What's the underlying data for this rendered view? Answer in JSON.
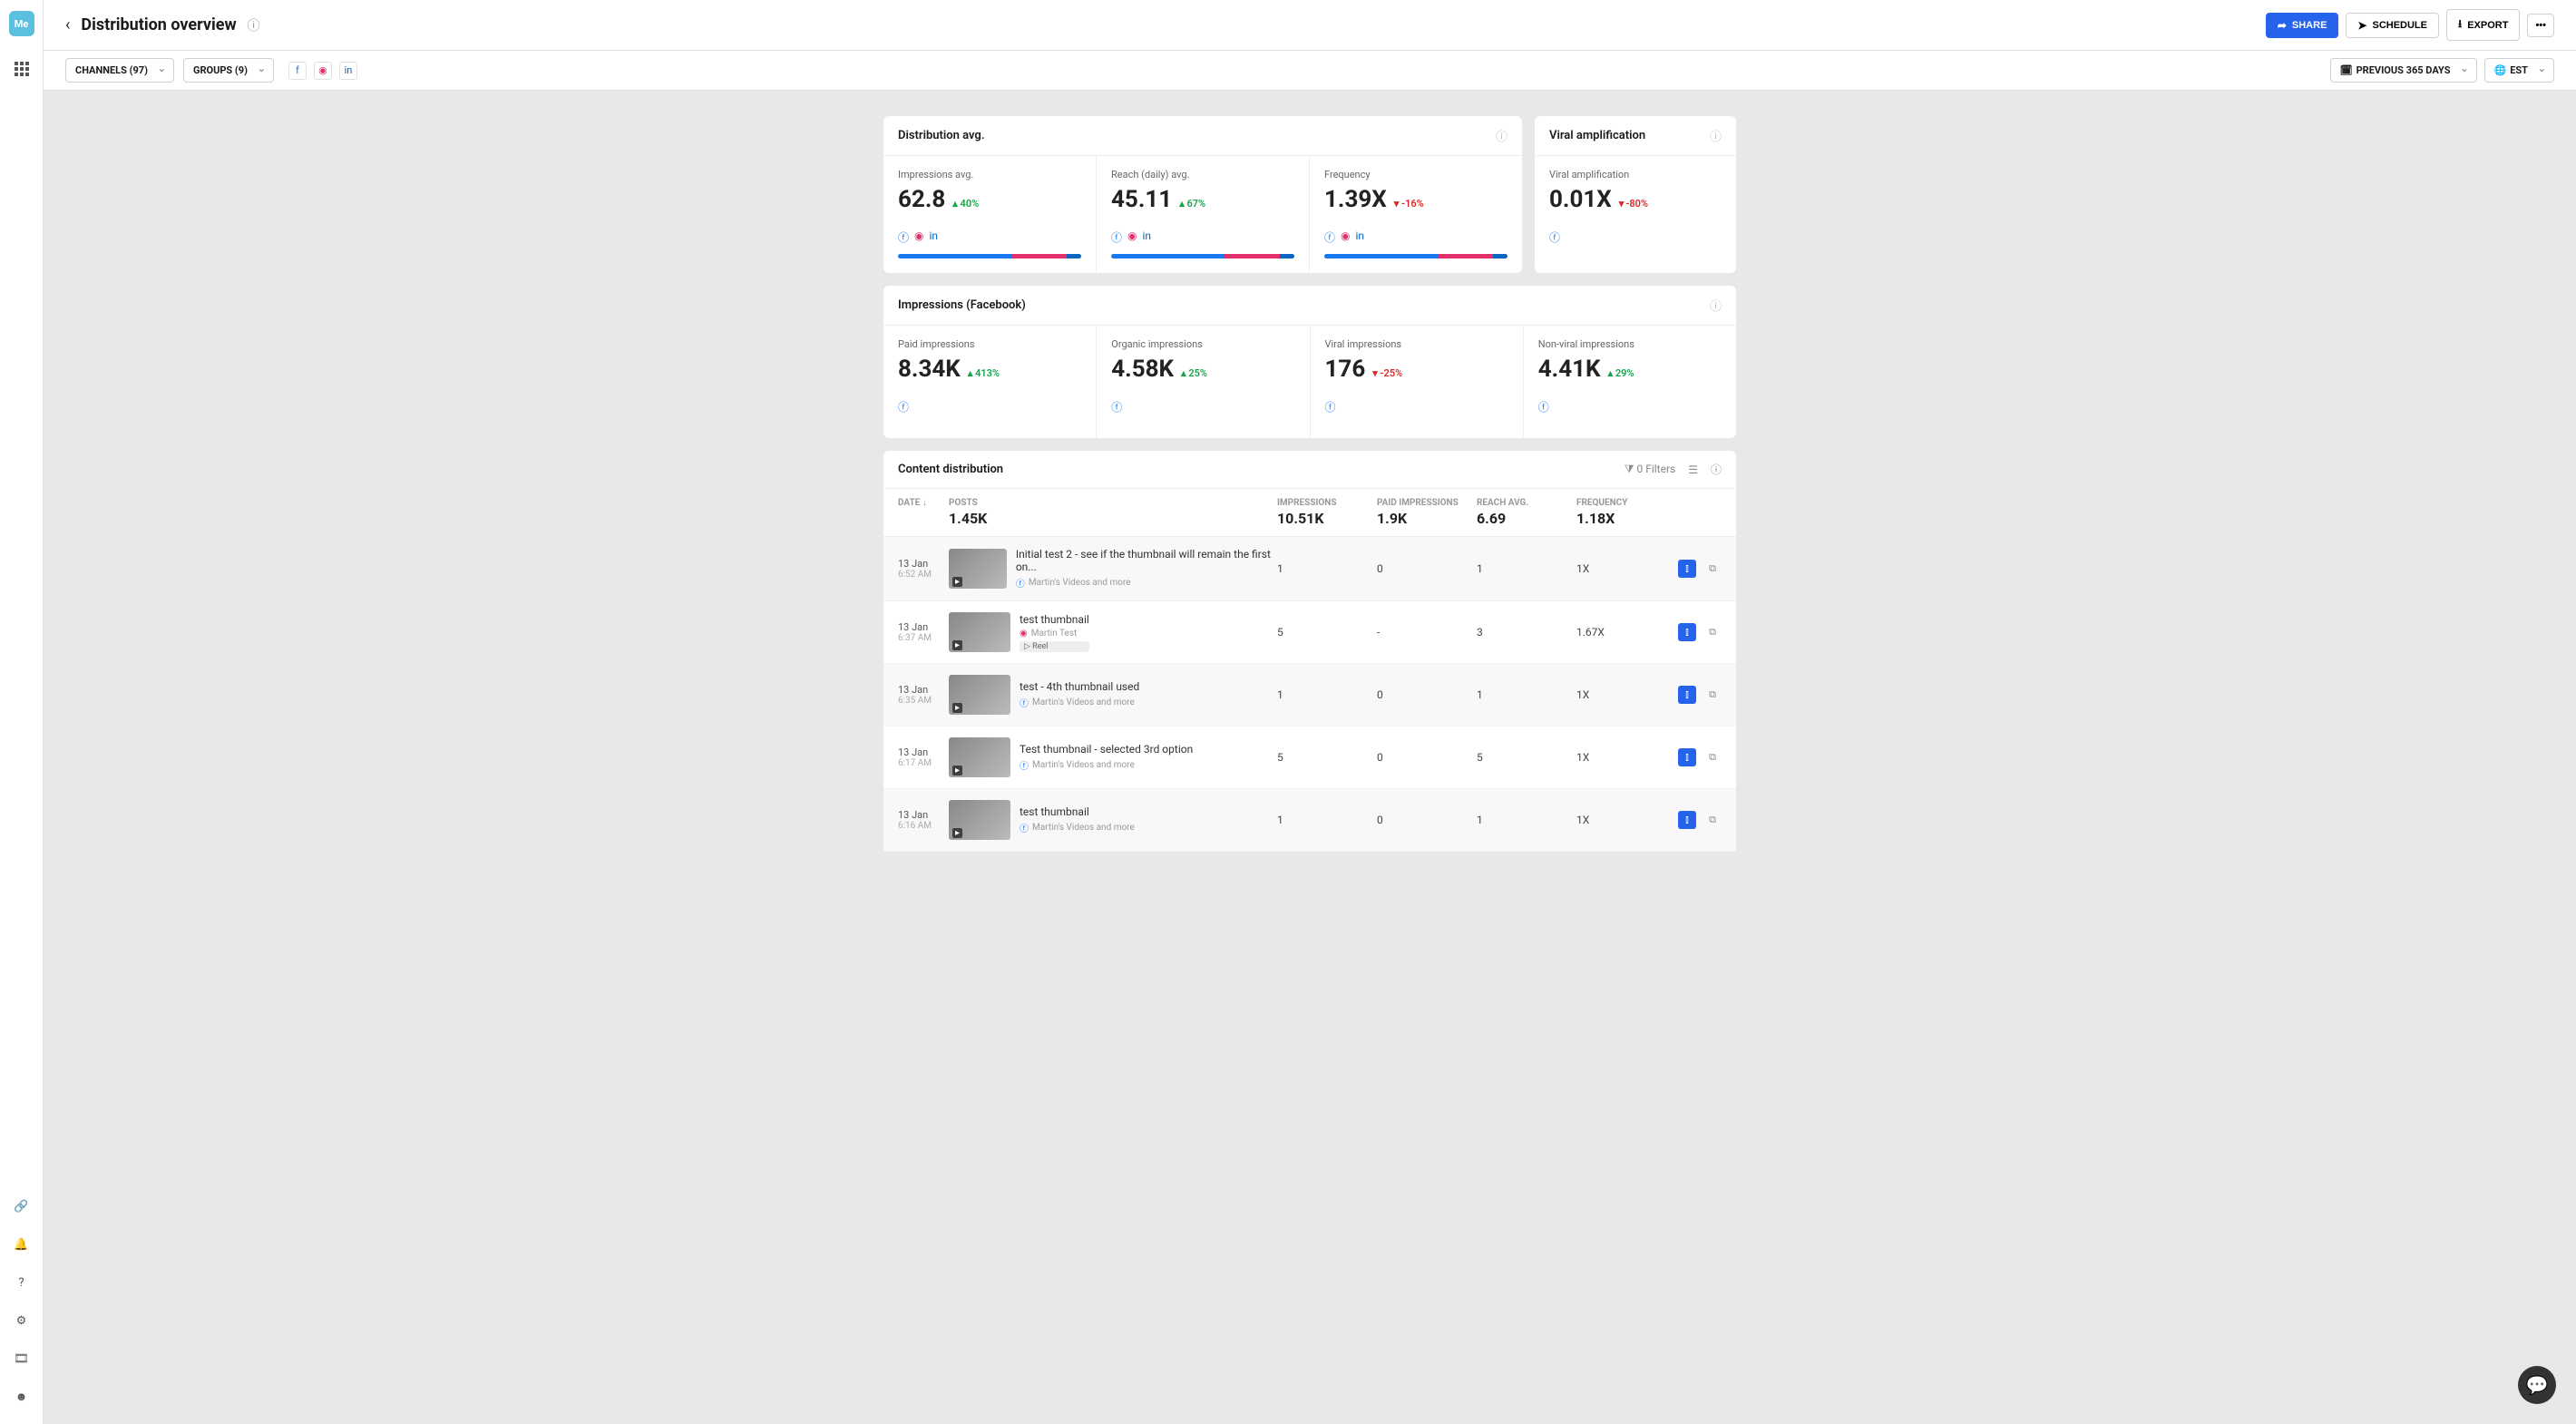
{
  "header": {
    "title": "Distribution overview",
    "share": "SHARE",
    "schedule": "SCHEDULE",
    "export": "EXPORT"
  },
  "filters": {
    "channels": "CHANNELS (97)",
    "groups": "GROUPS (9)",
    "daterange": "PREVIOUS 365 DAYS",
    "tz": "EST"
  },
  "dist_avg": {
    "title": "Distribution avg.",
    "metrics": [
      {
        "label": "Impressions avg.",
        "value": "62.8",
        "trend": "40%",
        "dir": "up"
      },
      {
        "label": "Reach (daily) avg.",
        "value": "45.11",
        "trend": "67%",
        "dir": "up"
      },
      {
        "label": "Frequency",
        "value": "1.39X",
        "trend": "-16%",
        "dir": "down"
      }
    ]
  },
  "viral": {
    "title": "Viral amplification",
    "label": "Viral amplification",
    "value": "0.01X",
    "trend": "-80%",
    "dir": "down"
  },
  "impressions_fb": {
    "title": "Impressions (Facebook)",
    "metrics": [
      {
        "label": "Paid impressions",
        "value": "8.34K",
        "trend": "413%",
        "dir": "up"
      },
      {
        "label": "Organic impressions",
        "value": "4.58K",
        "trend": "25%",
        "dir": "up"
      },
      {
        "label": "Viral impressions",
        "value": "176",
        "trend": "-25%",
        "dir": "down"
      },
      {
        "label": "Non-viral impressions",
        "value": "4.41K",
        "trend": "29%",
        "dir": "up"
      }
    ]
  },
  "table": {
    "title": "Content distribution",
    "filters_label": "0 Filters",
    "cols": {
      "date": "DATE",
      "posts": "POSTS",
      "impressions": "IMPRESSIONS",
      "paid": "PAID IMPRESSIONS",
      "reach": "REACH AVG.",
      "freq": "FREQUENCY"
    },
    "totals": {
      "posts": "1.45K",
      "impressions": "10.51K",
      "paid": "1.9K",
      "reach": "6.69",
      "freq": "1.18X"
    },
    "rows": [
      {
        "date": "13 Jan",
        "time": "6:52 AM",
        "title": "Initial test 2 - see if the thumbnail will remain the first on...",
        "sub": "Martin's Videos and more",
        "platform": "fb",
        "imp": "1",
        "paid": "0",
        "reach": "1",
        "freq": "1X"
      },
      {
        "date": "13 Jan",
        "time": "6:37 AM",
        "title": "test thumbnail",
        "sub": "Martin Test",
        "platform": "ig",
        "reel": "Reel",
        "imp": "5",
        "paid": "-",
        "reach": "3",
        "freq": "1.67X"
      },
      {
        "date": "13 Jan",
        "time": "6:35 AM",
        "title": "test - 4th thumbnail used",
        "sub": "Martin's Videos and more",
        "platform": "fb",
        "imp": "1",
        "paid": "0",
        "reach": "1",
        "freq": "1X"
      },
      {
        "date": "13 Jan",
        "time": "6:17 AM",
        "title": "Test thumbnail - selected 3rd option",
        "sub": "Martin's Videos and more",
        "platform": "fb",
        "imp": "5",
        "paid": "0",
        "reach": "5",
        "freq": "1X"
      },
      {
        "date": "13 Jan",
        "time": "6:16 AM",
        "title": "test thumbnail",
        "sub": "Martin's Videos and more",
        "platform": "fb",
        "imp": "1",
        "paid": "0",
        "reach": "1",
        "freq": "1X"
      }
    ]
  }
}
